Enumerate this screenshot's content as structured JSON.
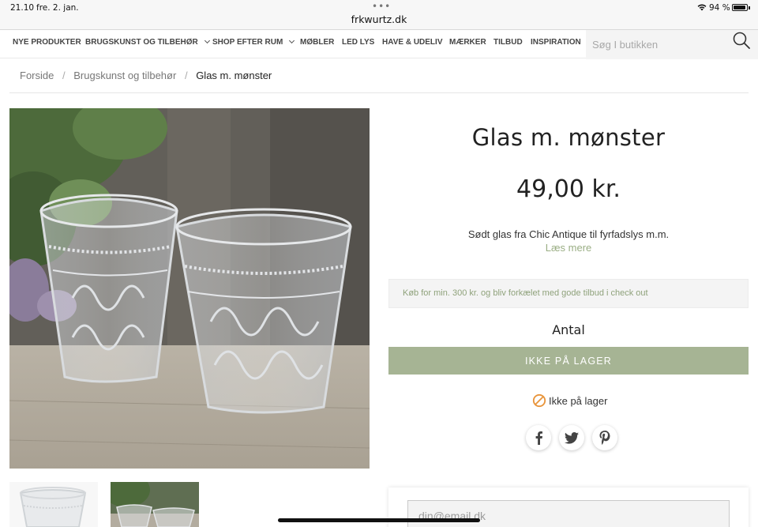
{
  "status_bar": {
    "time": "21.10",
    "date": "fre. 2. jan.",
    "url": "frkwurtz.dk",
    "battery_percent": "94 %",
    "battery_level": 0.94
  },
  "nav": {
    "items": [
      {
        "label": "NYE PRODUKTER",
        "has_dropdown": false
      },
      {
        "label": "BRUGSKUNST OG TILBEHØR",
        "has_dropdown": true
      },
      {
        "label": "SHOP EFTER RUM",
        "has_dropdown": true
      },
      {
        "label": "MØBLER",
        "has_dropdown": false
      },
      {
        "label": "LED LYS",
        "has_dropdown": false
      },
      {
        "label": "HAVE & UDELIV",
        "has_dropdown": false
      },
      {
        "label": "MÆRKER",
        "has_dropdown": false
      },
      {
        "label": "TILBUD",
        "has_dropdown": false
      },
      {
        "label": "INSPIRATION",
        "has_dropdown": false
      }
    ],
    "search_placeholder": "Søg I butikken"
  },
  "breadcrumb": {
    "items": [
      "Forside",
      "Brugskunst og tilbehør",
      "Glas m. mønster"
    ],
    "separator": "/"
  },
  "product": {
    "title": "Glas m. mønster",
    "price": "49,00 kr.",
    "description": "Sødt glas fra Chic Antique til fyrfadslys m.m.",
    "read_more": "Læs mere",
    "promo": "Køb for min. 300 kr. og bliv forkælet med gode tilbud i check out",
    "quantity_label": "Antal",
    "button_label": "IKKE PÅ LAGER",
    "stock_status": "Ikke på lager"
  },
  "share": {
    "icons": [
      "facebook-icon",
      "twitter-icon",
      "pinterest-icon"
    ]
  },
  "newsletter": {
    "email_placeholder": "din@email.dk"
  },
  "colors": {
    "accent": "#a6b494",
    "link": "#9aae84",
    "stock_icon": "#e8943a"
  }
}
